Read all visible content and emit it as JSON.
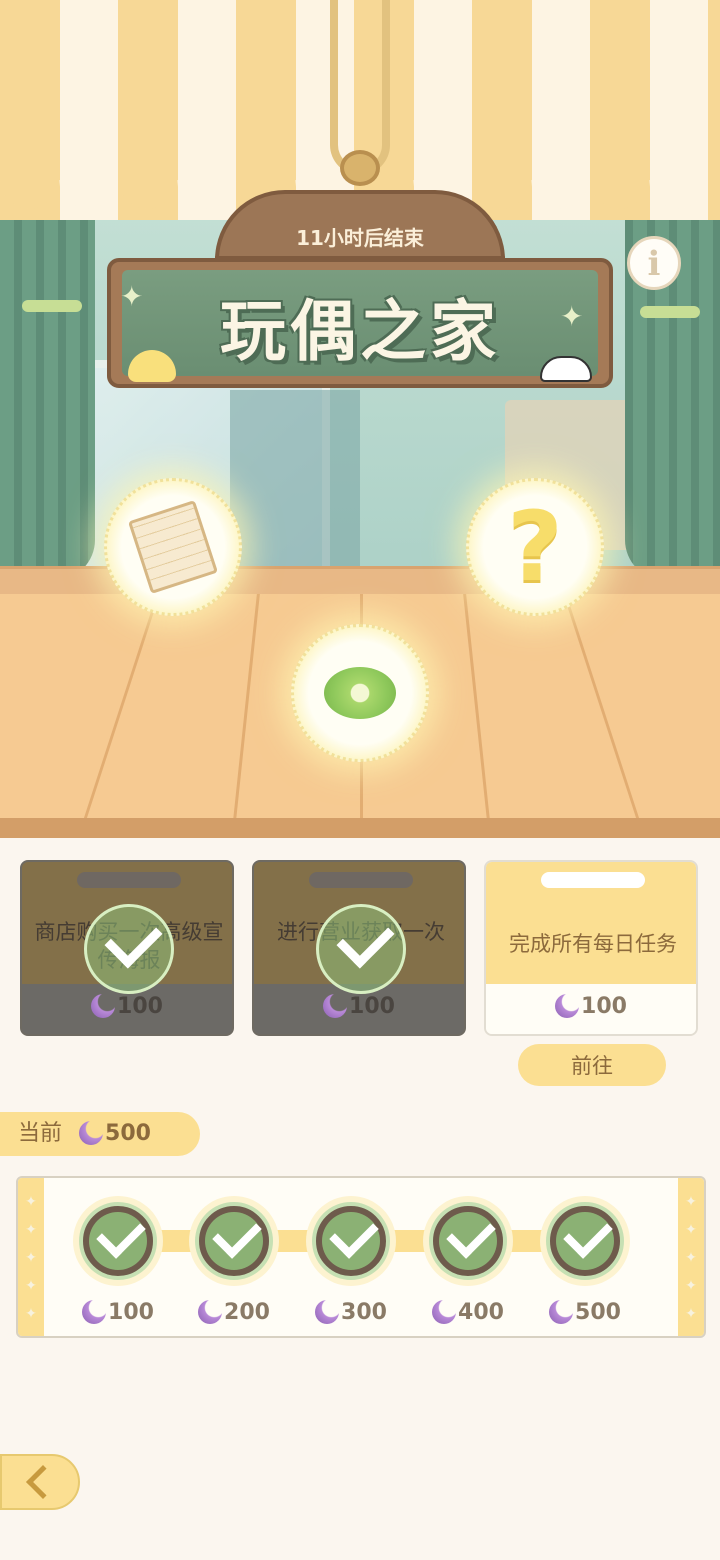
{
  "sign": {
    "countdown": "11小时后结束",
    "title": "玩偶之家"
  },
  "items": [
    {
      "icon": "notebook-icon"
    },
    {
      "icon": "question-mark-icon",
      "glyph": "?"
    },
    {
      "icon": "ribbon-icon"
    }
  ],
  "tasks": [
    {
      "label": "商店购买一次高级宣传海报",
      "reward": "100",
      "completed": true
    },
    {
      "label": "进行营业获取一次",
      "reward": "100",
      "completed": true
    },
    {
      "label": "完成所有每日任务",
      "reward": "100",
      "completed": false
    }
  ],
  "goto_button": "前往",
  "current": {
    "label": "当前",
    "value": "500"
  },
  "milestones": [
    {
      "value": "100",
      "claimed": true
    },
    {
      "value": "200",
      "claimed": true
    },
    {
      "value": "300",
      "claimed": true
    },
    {
      "value": "400",
      "claimed": true
    },
    {
      "value": "500",
      "claimed": true
    }
  ],
  "colors": {
    "accent_yellow": "#fbdf92",
    "brown_text": "#8c6a3c",
    "sign_green": "#6a8e72",
    "check_green": "#c6e0b3"
  }
}
